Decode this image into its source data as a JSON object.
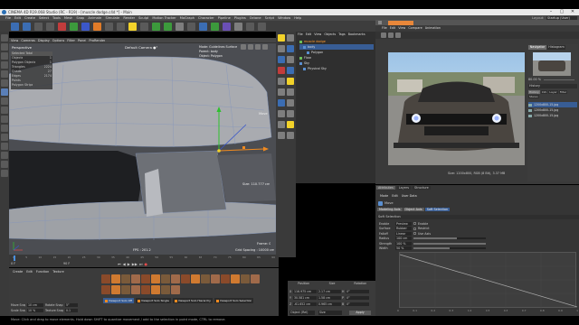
{
  "titlebar": {
    "title": "CINEMA 4D R19.068 Studio (RC - R19) - [muscle dodge.c4d *] - Main"
  },
  "menubar": {
    "items": [
      "File",
      "Edit",
      "Create",
      "Select",
      "Tools",
      "Mesh",
      "Snap",
      "Animate",
      "Simulate",
      "Render",
      "Sculpt",
      "Motion Tracker",
      "MoGraph",
      "Character",
      "Pipeline",
      "Plugins",
      "Octane",
      "Script",
      "Window",
      "Help"
    ],
    "layout_label": "Layout:",
    "layout_value": "Startup (User)"
  },
  "viewport": {
    "menu": [
      "View",
      "Cameras",
      "Display",
      "Options",
      "Filter",
      "Panel",
      "ProRender"
    ],
    "label": "Perspective",
    "camera": "Default Camera ●°",
    "hud": [
      {
        "k": "Selected Total",
        "v": ""
      },
      {
        "k": "Objects",
        "v": "1"
      },
      {
        "k": "Polygon Objects",
        "v": "1"
      },
      {
        "k": "Triangles",
        "v": "2224"
      },
      {
        "k": "Quads",
        "v": "27"
      },
      {
        "k": "Edges",
        "v": "2174"
      },
      {
        "k": "Points",
        "v": ""
      },
      {
        "k": "Polygon Strips",
        "v": ""
      }
    ],
    "right_hud": [
      "Mode: Guidelines Surface",
      "Parent: body",
      "Object: Polygon"
    ],
    "move_label": "Move",
    "size_readout": "Size: 110.777 cm",
    "fps": "FPS : 201.2",
    "frame": "Frame: 0",
    "grid": "Grid Spacing : 10000 cm"
  },
  "objmgr": {
    "menu": [
      "File",
      "Edit",
      "View",
      "Objects",
      "Tags",
      "Bookmarks"
    ],
    "items": [
      "muscle dodge",
      "body",
      "Polygon",
      "Floor",
      "Sky",
      "Physical Sky"
    ]
  },
  "picview": {
    "menu": [
      "File",
      "Edit",
      "View",
      "Compare",
      "Animation"
    ],
    "tab_navigator": "Navigator",
    "tab_histogram": "Histogram",
    "zoom": "80.00 %",
    "history": "History",
    "filter_tabs": [
      "History",
      "Info",
      "Layer",
      "Filter",
      "Stereo"
    ],
    "files": [
      "1200x800-15.jpg",
      "1200x800-15.jpg",
      "1200x800-15.jpg"
    ],
    "size_text": "Size: 1200x800, RGB (8 Bit), 3.37 MB"
  },
  "attrmgr": {
    "tabs_top": [
      "Attributes",
      "Layers",
      "Structure"
    ],
    "menu": [
      "Mode",
      "Edit",
      "User Data"
    ],
    "section": "Move",
    "tabs": [
      "Modeling Axis",
      "Object Axis",
      "Soft Selection"
    ],
    "heading": "Soft Selection",
    "fields": [
      {
        "k": "Enable",
        "v": "Preview",
        "checkbox": "Enable"
      },
      {
        "k": "Surface",
        "v": "Rubber",
        "checkbox": "Restrict"
      },
      {
        "k": "Falloff",
        "v": "Linear",
        "checkbox": "Use Axis"
      },
      {
        "k": "Radius",
        "v": "100 cm",
        "slider": 0.6
      },
      {
        "k": "Strength",
        "v": "100 %",
        "slider": 1.0
      },
      {
        "k": "Width",
        "v": "50 %",
        "slider": 0.5
      }
    ],
    "graph_x_ticks": [
      "0",
      "0.1",
      "0.2",
      "0.3",
      "0.4",
      "0.5",
      "0.6",
      "0.7",
      "0.8",
      "0.9",
      "1"
    ]
  },
  "timeline": {
    "ticks": [
      "0",
      "5",
      "10",
      "15",
      "20",
      "25",
      "30",
      "35",
      "40",
      "45",
      "50",
      "55",
      "60",
      "65",
      "70",
      "75",
      "80",
      "85",
      "90"
    ],
    "frame_start": "0 F",
    "frame_end": "90 F"
  },
  "materials": {
    "menu": [
      "Create",
      "Edit",
      "Function",
      "Texture"
    ],
    "buttons": [
      "Viewport Solo Off",
      "Viewport Solo Single",
      "Viewport Solo Hierarchy",
      "Viewport Solo Selection"
    ],
    "options": [
      {
        "k": "Move Snap",
        "v": "10 cm",
        "k2": "Rotate Snap",
        "v2": "5°"
      },
      {
        "k": "Scale Snap",
        "v": "10 %",
        "k2": "Texture Snap",
        "v2": "0.1"
      }
    ]
  },
  "coords": {
    "headers": [
      "Position",
      "Size",
      "Rotation"
    ],
    "rows": [
      {
        "a": "X",
        "p": "116.975 cm",
        "s": "2.17 cm",
        "r": "H",
        "rv": "0°"
      },
      {
        "a": "Y",
        "p": "30.581 cm",
        "s": "1.58 cm",
        "r": "P",
        "rv": "0°"
      },
      {
        "a": "Z",
        "p": "-61.652 cm",
        "s": "0.965 cm",
        "r": "B",
        "rv": "0°"
      }
    ],
    "mode": "Object (Rel)",
    "size_mode": "Size",
    "apply": "Apply"
  },
  "statusbar": {
    "text": "Move: Click and drag to move elements. Hold down SHIFT to quantize movement / add to the selection in point mode, CTRL to remove."
  },
  "colors": {
    "accent_orange": "#f08a20",
    "selected_blue": "#385d95",
    "viewport_bg": "#4b4d52"
  }
}
